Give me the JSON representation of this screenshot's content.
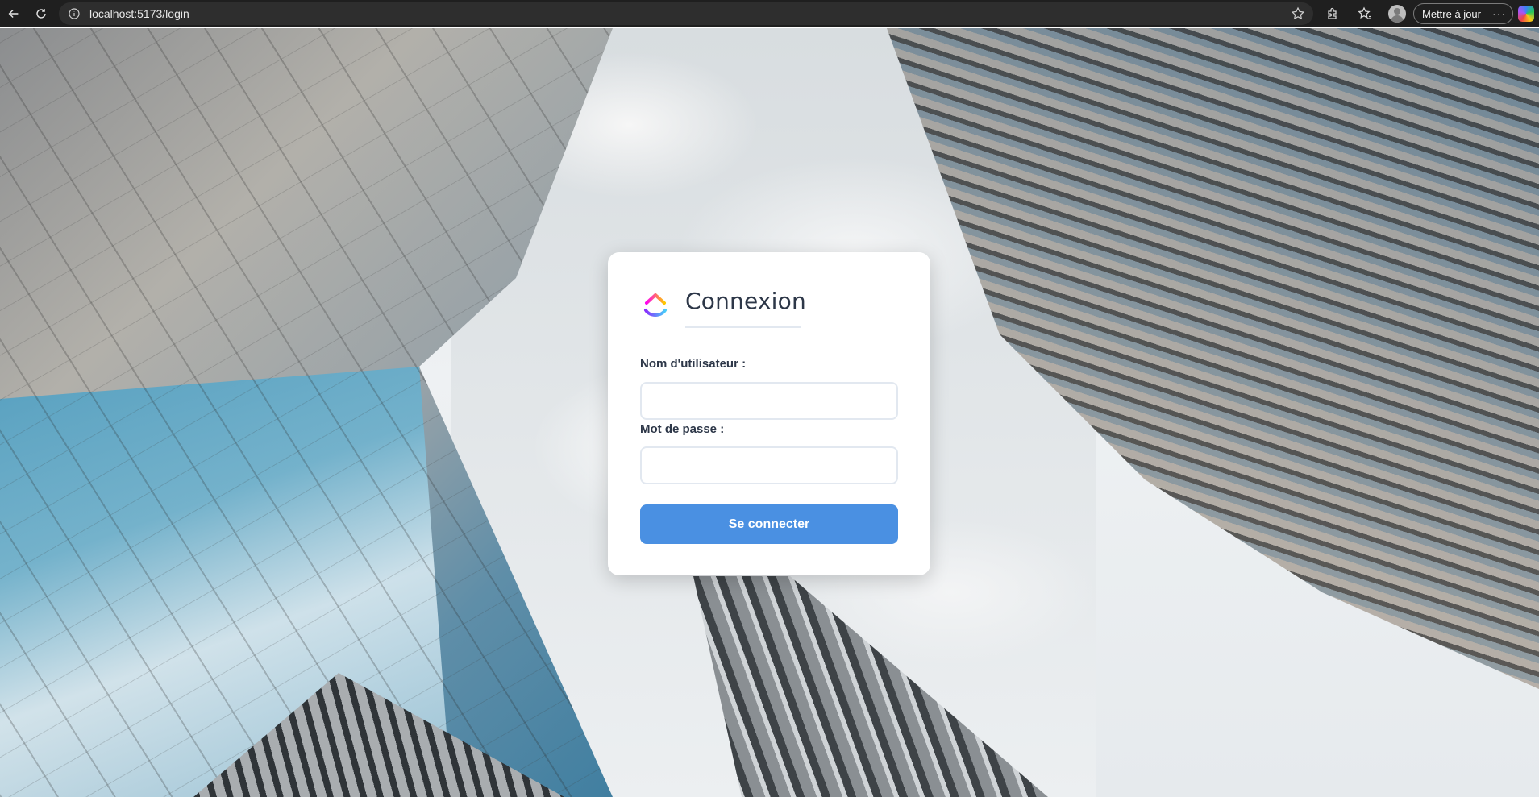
{
  "browser": {
    "url": "localhost:5173/login",
    "update_label": "Mettre à jour",
    "more_label": "···"
  },
  "icons": {
    "back": "back-arrow-icon",
    "reload": "reload-icon",
    "info": "info-icon",
    "favorite": "star-icon",
    "extensions": "puzzle-icon",
    "collections": "favorites-icon",
    "profile": "avatar-icon",
    "copilot": "copilot-icon",
    "app_logo": "clickup-logo-icon"
  },
  "login": {
    "title": "Connexion",
    "username_label": "Nom d'utilisateur :",
    "username_value": "",
    "password_label": "Mot de passe :",
    "password_value": "",
    "submit_label": "Se connecter"
  },
  "colors": {
    "accent": "#4a90e2",
    "heading": "#2d3748",
    "border": "#e2e8f0"
  }
}
